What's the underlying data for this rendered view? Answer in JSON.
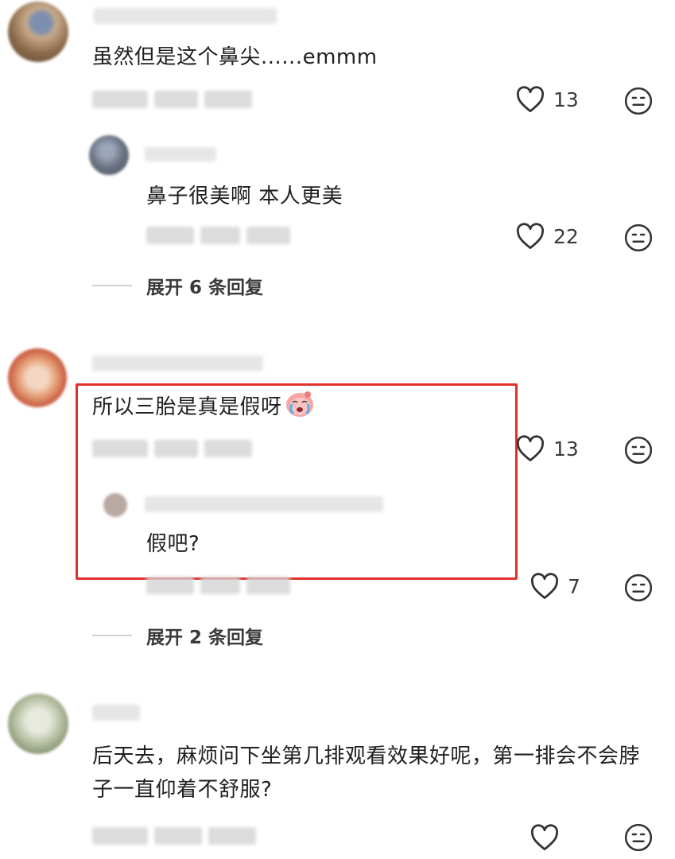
{
  "comments": [
    {
      "text": "虽然但是这个鼻尖......emmm",
      "likes": "13",
      "reply": {
        "text": "鼻子很美啊 本人更美",
        "likes": "22"
      },
      "expand_label": "展开 6 条回复"
    },
    {
      "text": "所以三胎是真是假呀",
      "likes": "13",
      "reply": {
        "text": "假吧?",
        "likes": "7"
      },
      "expand_label": "展开 2 条回复"
    },
    {
      "text": "后天去，麻烦问下坐第几排观看效果好呢，第一排会不会脖子一直仰着不舒服?",
      "likes": ""
    }
  ],
  "icons": {
    "like": "heart-outline-icon",
    "dislike": "neutral-face-icon",
    "emoji": "crying-face-emoji"
  },
  "colors": {
    "highlight": "#e0302c",
    "text": "#1f1f1f",
    "muted": "#3a3a3a"
  }
}
